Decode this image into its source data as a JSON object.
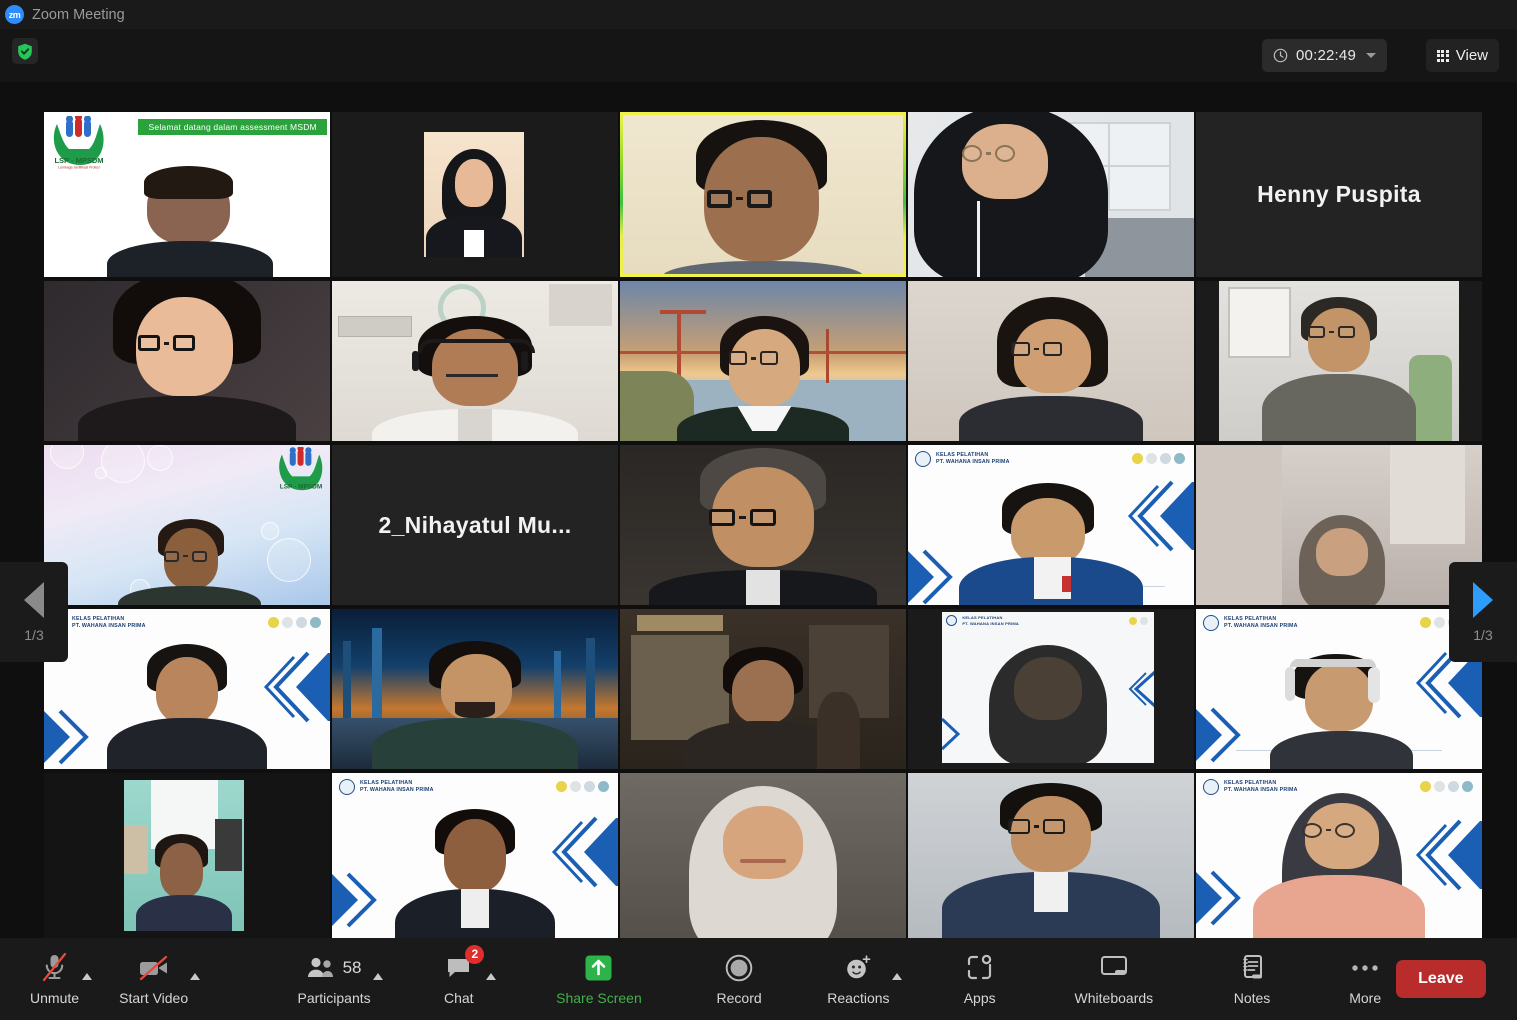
{
  "window": {
    "app_icon": "zoom-logo-icon",
    "title": "Zoom Meeting"
  },
  "header": {
    "security_icon": "shield-check-icon",
    "timer_icon": "clock-icon",
    "timer_value": "00:22:49",
    "timer_caret_icon": "chevron-down-icon",
    "view_icon": "grid-icon",
    "view_label": "View"
  },
  "gallery": {
    "page_prev_icon": "triangle-left-icon",
    "page_prev_label": "1/3",
    "page_next_icon": "triangle-right-icon",
    "page_next_label": "1/3",
    "active_speaker_index": 2,
    "columns": 5,
    "tiles": [
      {
        "id": 0,
        "kind": "video",
        "name": "",
        "bg": "lsp-banner",
        "banner": "Selamat datang dalam assessment MSDM"
      },
      {
        "id": 1,
        "kind": "video",
        "name": "",
        "bg": "portrait-inset"
      },
      {
        "id": 2,
        "kind": "video",
        "name": "",
        "bg": "plain-beige",
        "active": true
      },
      {
        "id": 3,
        "kind": "video",
        "name": "",
        "bg": "room-window"
      },
      {
        "id": 4,
        "kind": "name",
        "name": "Henny Puspita"
      },
      {
        "id": 5,
        "kind": "video",
        "name": "",
        "bg": "dark-room"
      },
      {
        "id": 6,
        "kind": "video",
        "name": "",
        "bg": "office-headset"
      },
      {
        "id": 7,
        "kind": "video",
        "name": "",
        "bg": "golden-gate"
      },
      {
        "id": 8,
        "kind": "video",
        "name": "",
        "bg": "plain-wall"
      },
      {
        "id": 9,
        "kind": "video",
        "name": "",
        "bg": "home-desk"
      },
      {
        "id": 10,
        "kind": "video",
        "name": "",
        "bg": "lsp-bubbles"
      },
      {
        "id": 11,
        "kind": "name",
        "name": "2_Nihayatul  Mu..."
      },
      {
        "id": 12,
        "kind": "video",
        "name": "",
        "bg": "dark-room2"
      },
      {
        "id": 13,
        "kind": "video",
        "name": "",
        "bg": "wip",
        "wip_title_1": "KELAS PELATIHAN",
        "wip_title_2": "PT. WAHANA INSAN PRIMA"
      },
      {
        "id": 14,
        "kind": "video",
        "name": "",
        "bg": "blur-room"
      },
      {
        "id": 15,
        "kind": "video",
        "name": "",
        "bg": "wip",
        "wip_title_1": "KELAS PELATIHAN",
        "wip_title_2": "PT. WAHANA INSAN PRIMA"
      },
      {
        "id": 16,
        "kind": "video",
        "name": "",
        "bg": "scifi-city"
      },
      {
        "id": 17,
        "kind": "video",
        "name": "",
        "bg": "indoor-dim"
      },
      {
        "id": 18,
        "kind": "video",
        "name": "",
        "bg": "wip-small",
        "wip_title_1": "KELAS PELATIHAN",
        "wip_title_2": "PT. WAHANA INSAN PRIMA"
      },
      {
        "id": 19,
        "kind": "video",
        "name": "",
        "bg": "wip",
        "wip_title_1": "KELAS PELATIHAN",
        "wip_title_2": "PT. WAHANA INSAN PRIMA"
      },
      {
        "id": 20,
        "kind": "video",
        "name": "",
        "bg": "teal-room"
      },
      {
        "id": 21,
        "kind": "video",
        "name": "",
        "bg": "wip",
        "wip_title_1": "KELAS PELATIHAN",
        "wip_title_2": "PT. WAHANA INSAN PRIMA"
      },
      {
        "id": 22,
        "kind": "video",
        "name": "",
        "bg": "light-wall"
      },
      {
        "id": 23,
        "kind": "video",
        "name": "",
        "bg": "grey-wall"
      },
      {
        "id": 24,
        "kind": "video",
        "name": "",
        "bg": "wip",
        "wip_title_1": "KELAS PELATIHAN",
        "wip_title_2": "PT. WAHANA INSAN PRIMA"
      }
    ]
  },
  "toolbar": {
    "mute": {
      "icon": "microphone-muted-icon",
      "label": "Unmute"
    },
    "video": {
      "icon": "camera-off-icon",
      "label": "Start Video"
    },
    "participants": {
      "icon": "participants-icon",
      "label": "Participants",
      "count": "58"
    },
    "chat": {
      "icon": "chat-bubble-icon",
      "label": "Chat",
      "badge": "2"
    },
    "share": {
      "icon": "share-screen-up-arrow-icon",
      "label": "Share Screen"
    },
    "record": {
      "icon": "record-circle-icon",
      "label": "Record"
    },
    "reactions": {
      "icon": "smiley-plus-icon",
      "label": "Reactions"
    },
    "apps": {
      "icon": "apps-icon",
      "label": "Apps"
    },
    "whiteboards": {
      "icon": "whiteboard-icon",
      "label": "Whiteboards"
    },
    "notes": {
      "icon": "notes-icon",
      "label": "Notes"
    },
    "more": {
      "icon": "ellipsis-icon",
      "label": "More"
    },
    "leave": {
      "label": "Leave"
    }
  },
  "colors": {
    "accent_blue": "#2d8cff",
    "leave_red": "#b92c2c",
    "share_green": "#3fb24a",
    "badge_red": "#e02d2d",
    "active_border": "#d8e330",
    "window_bg": "#0f0f0f"
  }
}
